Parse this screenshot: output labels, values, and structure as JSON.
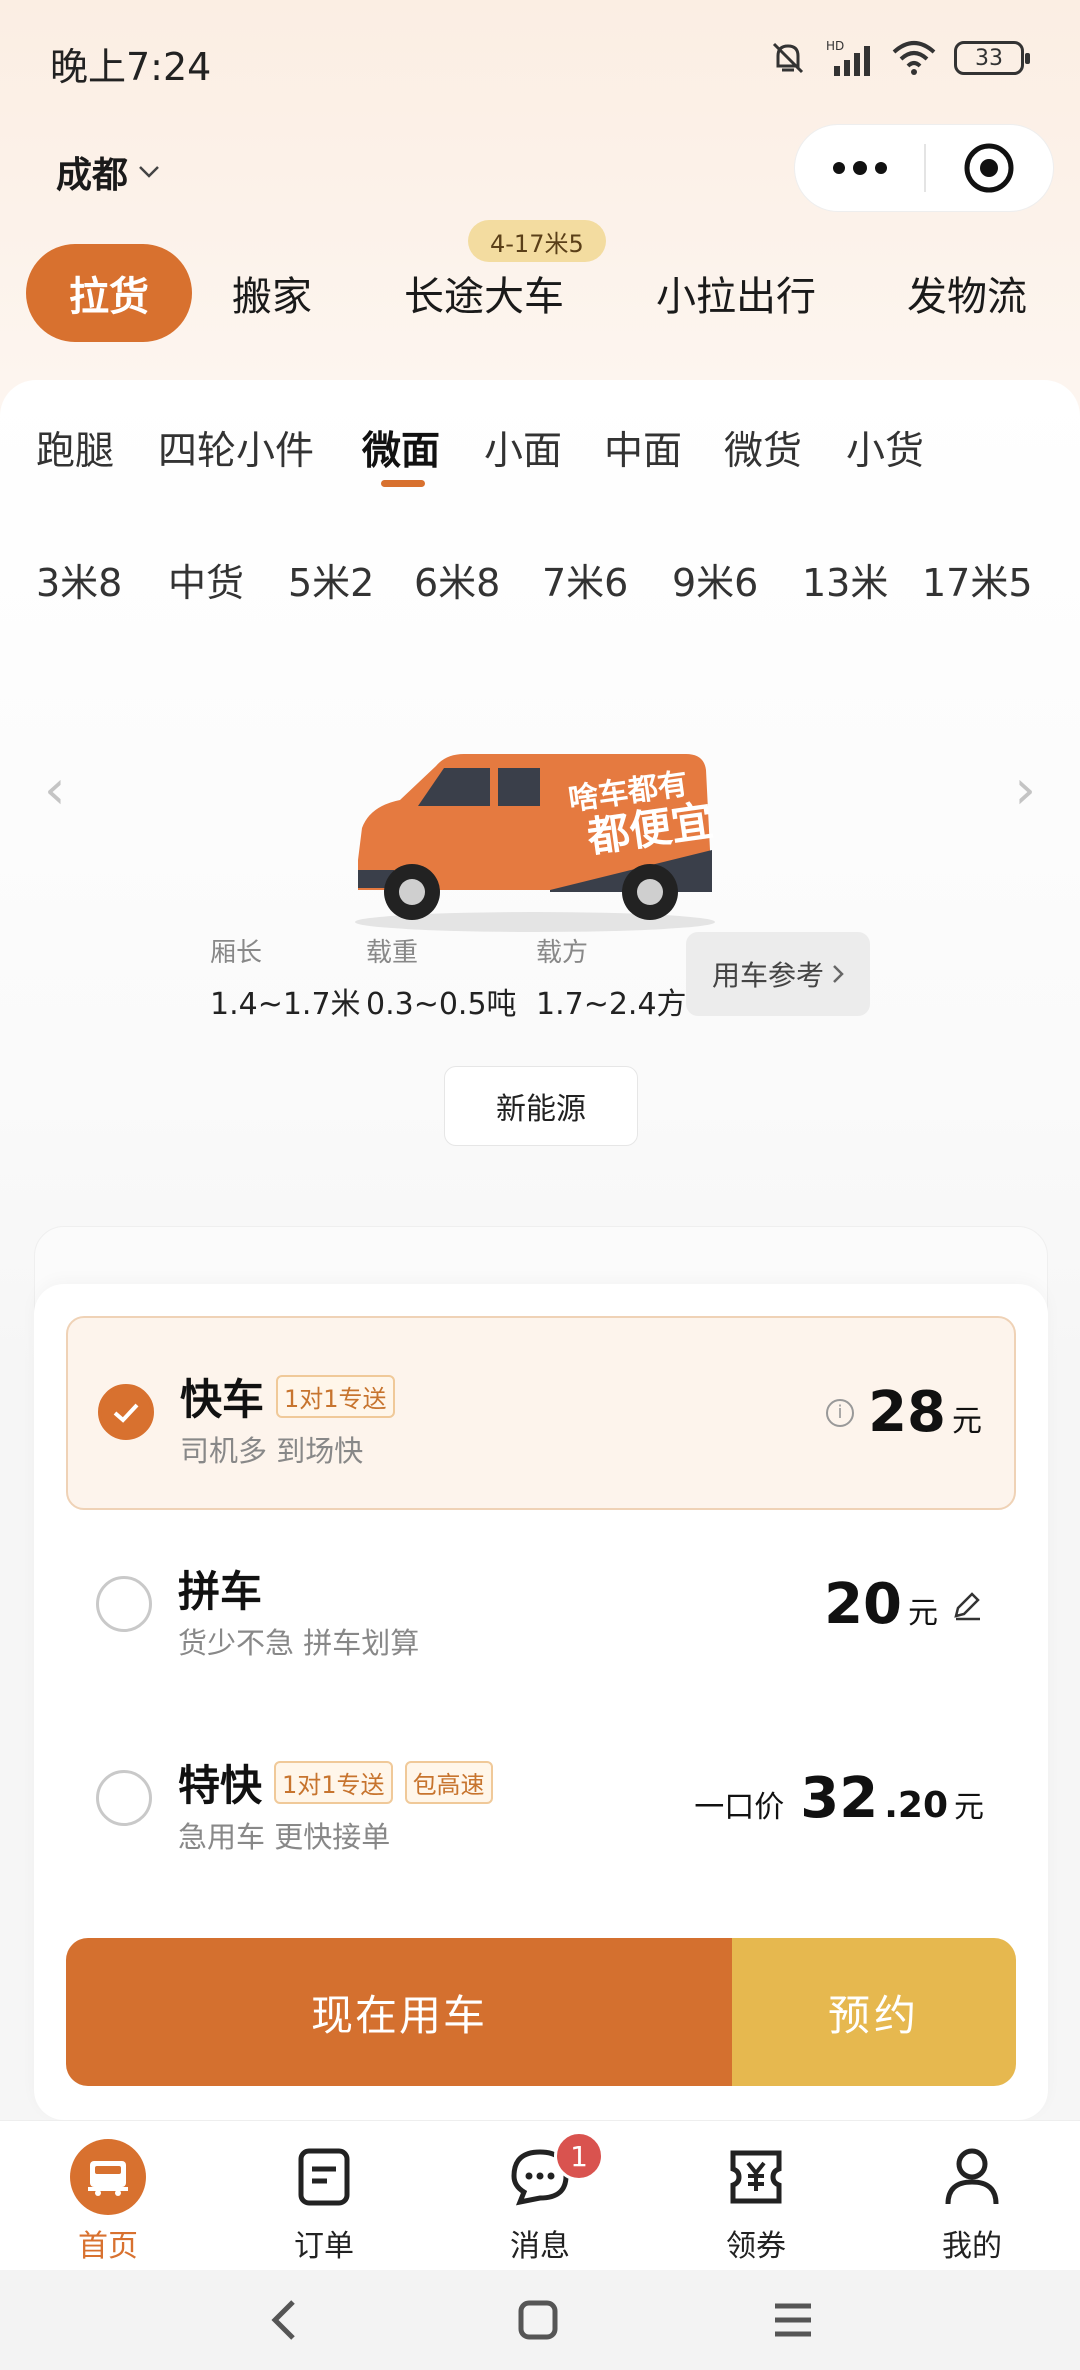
{
  "status_bar": {
    "time": "晚上7:24",
    "network": "HD",
    "battery": "33"
  },
  "header": {
    "city": "成都"
  },
  "top_tabs": [
    {
      "label": "拉货",
      "active": true
    },
    {
      "label": "搬家",
      "active": false
    },
    {
      "label": "长途大车",
      "active": false
    },
    {
      "label": "小拉出行",
      "active": false
    },
    {
      "label": "发物流",
      "active": false
    }
  ],
  "top_tab_badge": "4-17米5",
  "vehicle_tabs": [
    {
      "label": "跑腿"
    },
    {
      "label": "四轮小件"
    },
    {
      "label": "微面",
      "active": true
    },
    {
      "label": "小面"
    },
    {
      "label": "中面"
    },
    {
      "label": "微货"
    },
    {
      "label": "小货"
    }
  ],
  "size_tabs": [
    "3米8",
    "中货",
    "5米2",
    "6米8",
    "7米6",
    "9米6",
    "13米",
    "17米5"
  ],
  "vehicle": {
    "ad_text_line1": "啥车都有",
    "ad_text_line2": "都便宜",
    "specs": [
      {
        "label": "厢长",
        "value": "1.4~1.7米"
      },
      {
        "label": "载重",
        "value": "0.3~0.5吨"
      },
      {
        "label": "载方",
        "value": "1.7~2.4方"
      }
    ],
    "reference_label": "用车参考",
    "energy_button": "新能源"
  },
  "options": [
    {
      "title": "快车",
      "tags": [
        "1对1专送"
      ],
      "subtitle": "司机多 到场快",
      "price": "28",
      "unit": "元",
      "selected": true
    },
    {
      "title": "拼车",
      "tags": [],
      "subtitle": "货少不急 拼车划算",
      "price": "20",
      "unit": "元",
      "selected": false
    },
    {
      "title": "特快",
      "tags": [
        "1对1专送",
        "包高速"
      ],
      "subtitle": "急用车 更快接单",
      "price_prefix": "一口价",
      "price": "32",
      "price_decimal": ".20",
      "unit": "元",
      "selected": false
    }
  ],
  "actions": {
    "now": "现在用车",
    "book": "预约"
  },
  "bottom_nav": [
    {
      "label": "首页",
      "active": true
    },
    {
      "label": "订单"
    },
    {
      "label": "消息",
      "badge": "1"
    },
    {
      "label": "领券"
    },
    {
      "label": "我的"
    }
  ],
  "colors": {
    "accent": "#d8712f",
    "book": "#e6b84f",
    "selected_bg": "#fdf4ec"
  }
}
